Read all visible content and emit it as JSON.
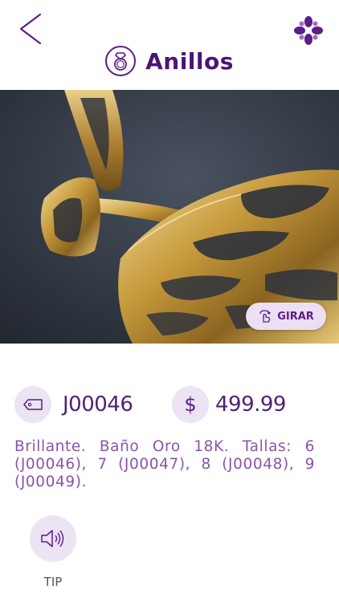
{
  "header": {
    "title": "Anillos",
    "back_icon": "chevron-left-icon",
    "menu_icon": "flower-menu-icon",
    "category_icon": "ring-icon"
  },
  "image": {
    "girar_label": "GIRAR",
    "girar_icon": "rotate-hand-icon"
  },
  "product": {
    "code": "J00046",
    "currency_symbol": "$",
    "price": "499.99",
    "description": "Brillante. Baño Oro 18K. Tallas: 6 (J00046), 7 (J00047), 8 (J00048), 9 (J00049)."
  },
  "tip": {
    "label": "TIP",
    "icon": "speaker-icon"
  },
  "colors": {
    "accent": "#5a1d8a",
    "title": "#4b1478",
    "description": "#8a54a8",
    "icon_bg": "#ece3f3"
  }
}
